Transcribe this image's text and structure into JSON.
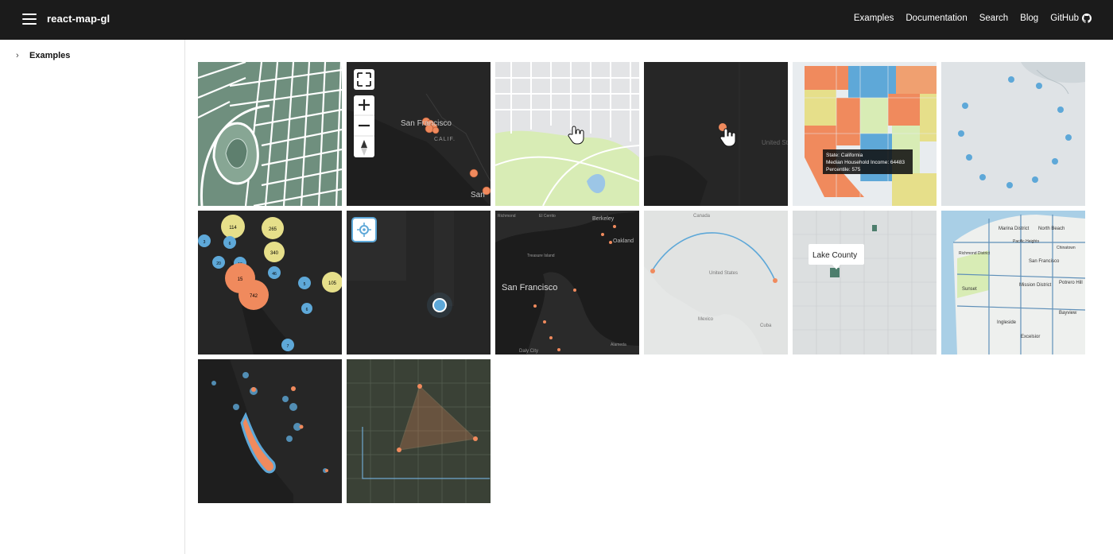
{
  "header": {
    "brand": "react-map-gl",
    "nav": [
      {
        "label": "Examples"
      },
      {
        "label": "Documentation"
      },
      {
        "label": "Search"
      },
      {
        "label": "Blog"
      },
      {
        "label": "GitHub"
      }
    ]
  },
  "sidebar": {
    "items": [
      {
        "label": "Examples",
        "icon": "chevron-right-icon"
      }
    ]
  },
  "tiles": {
    "controls": {
      "city": "San Francisco",
      "state": "CALIF.",
      "city_partial": "San"
    },
    "markers": {
      "label": "United States"
    },
    "choropleth": {
      "tooltip_state": "State: California",
      "tooltip_income": "Median Household Income: 64483",
      "tooltip_percentile": "Percentile: 575"
    },
    "clusters": {
      "counts": [
        "114",
        "265",
        "340",
        "3",
        "6",
        "20",
        "16",
        "15",
        "46",
        "742",
        "5",
        "105",
        "6",
        "7"
      ]
    },
    "dark": {
      "city": "San Francisco",
      "places": [
        "Berkeley",
        "Oakland",
        "Daly City",
        "Treasure Island",
        "Richmond",
        "El Cerrito",
        "Alameda"
      ]
    },
    "arc": {
      "country_north": "Canada",
      "country": "United States",
      "country_south": "Mexico",
      "cuba": "Cuba"
    },
    "filter": {
      "popup": "Lake County"
    },
    "sfmap": {
      "districts": [
        "Marina District",
        "North Beach",
        "San Francisco",
        "Sunset",
        "Mission District",
        "Potrero Hill",
        "Ingleside",
        "Bayview",
        "Excelsior",
        "Pacific Heights",
        "Richmond District",
        "Chinatown"
      ]
    },
    "colors": {
      "dark": "#262626",
      "orange": "#f08a5d",
      "blue": "#5ea8d8",
      "yellow": "#e6df8a",
      "land": "#e5e7e6",
      "park": "#d8ecb5"
    }
  }
}
